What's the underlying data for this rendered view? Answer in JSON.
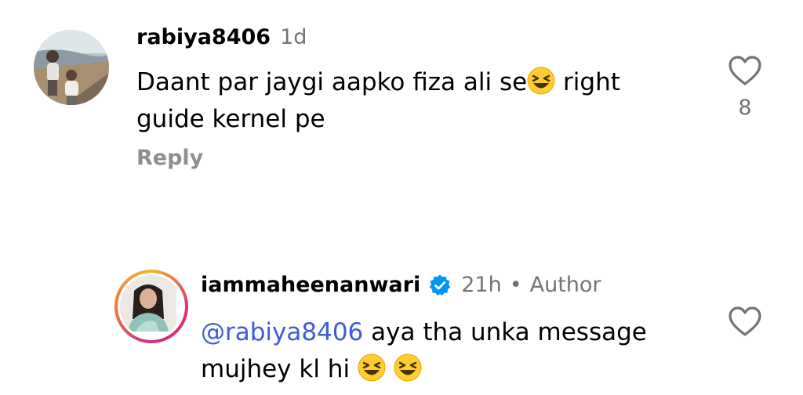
{
  "comments": [
    {
      "username": "rabiya8406",
      "timestamp": "1d",
      "text_line1": "Daant par jaygi aapko fiza ali se",
      "text_line1_after": " right",
      "text_line2": "guide kernel pe",
      "emoji": "laughing-face-emoji",
      "reply_label": "Reply",
      "like_count": "8"
    }
  ],
  "reply": {
    "username": "iammaheenanwari",
    "verified": true,
    "timestamp": "21h",
    "separator": "•",
    "author_label": "Author",
    "mention": "@rabiya8406",
    "text_line1": " aya tha unka message",
    "text_line2": "mujhey kl hi ",
    "emoji": "laughing-face-emoji",
    "emoji_count": 2
  },
  "colors": {
    "mention": "#3f5bd9",
    "verified_badge": "#0095f6",
    "secondary_text": "#737373",
    "emoji_face": "#ffcc33"
  }
}
